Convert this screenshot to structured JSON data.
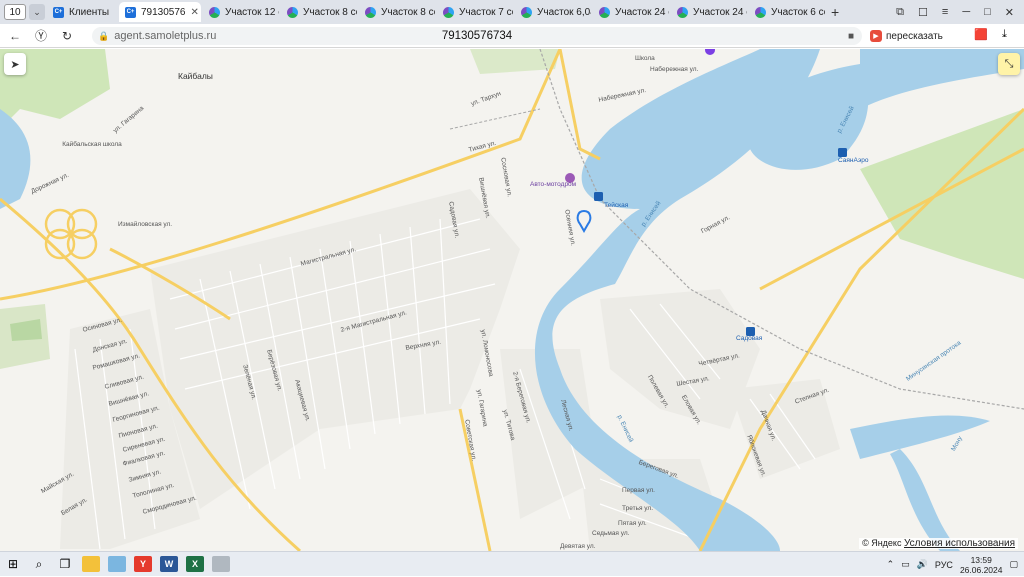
{
  "tabs": {
    "counter": "10",
    "items": [
      {
        "label": "Клиенты",
        "icon": "crm-c-icon",
        "active": false
      },
      {
        "label": "79130576",
        "icon": "crm-c-icon",
        "active": true
      },
      {
        "label": "Участок 12 со",
        "icon": "avito-icon",
        "active": false
      },
      {
        "label": "Участок 8 сот",
        "icon": "avito-icon",
        "active": false
      },
      {
        "label": "Участок 8 сот",
        "icon": "avito-icon",
        "active": false
      },
      {
        "label": "Участок 7 сот",
        "icon": "avito-icon",
        "active": false
      },
      {
        "label": "Участок 6,04",
        "icon": "avito-icon",
        "active": false
      },
      {
        "label": "Участок 24 со",
        "icon": "avito-icon",
        "active": false
      },
      {
        "label": "Участок 24 со",
        "icon": "avito-icon",
        "active": false
      },
      {
        "label": "Участок 6 сот",
        "icon": "avito-icon",
        "active": false
      }
    ]
  },
  "address": {
    "url": "agent.samoletplus.ru",
    "page_title": "79130576734",
    "translate_label": "пересказать"
  },
  "map": {
    "labels": {
      "kaibaly": "Кайбалы",
      "school_kaibaly": "Кайбальская школа",
      "school": "Школа",
      "auto_motodrom": "Авто-мотодром",
      "station_teyskaya": "Тейская",
      "station_sadovaya": "Садовая",
      "sayanaero": "СаянАэро",
      "river_enisey_1": "р. Енисей",
      "river_enisey_2": "р. Енисей",
      "river_enisey_3": "р. Енисей",
      "mountain_canal": "Минусинская протока",
      "monu": "Мону",
      "st_izmaylovskaya": "Измайловская ул.",
      "st_magistralnaya": "Магистральная ул.",
      "st_2_magistralnaya": "2-я Магистральная ул.",
      "st_verkhnyaya": "Верхняя ул.",
      "st_naberezhnaya": "Набережная ул.",
      "st_naberezhnaya2": "Набережная ул.",
      "st_gornaya": "Горная ул.",
      "st_tikhaya": "Тихая ул.",
      "st_sovetskaya": "Советская ул.",
      "st_2_beregovaya": "2-я Береговая ул.",
      "st_beregovaya": "Береговая ул.",
      "st_pervaya": "Первая ул.",
      "st_tretya": "Третья ул.",
      "st_pyataya": "Пятая ул.",
      "st_sedmaya": "Седьмая ул.",
      "st_devyataya": "Девятая ул.",
      "st_shestaya": "Шестая ул.",
      "st_chetvertaya": "Четвёртая ул.",
      "st_osinovaya": "Осиновая ул.",
      "st_donskaya": "Донская ул.",
      "st_romashkovaya": "Ромашковая ул.",
      "st_slivovaya": "Сливовая ул.",
      "st_vishnevaya": "Вишнёвая ул.",
      "st_georginovaya": "Георгиновая ул.",
      "st_pionovaya": "Пионовая ул.",
      "st_sirenevaya": "Сиреневая ул.",
      "st_fialkovaya": "Фиалковая ул.",
      "st_zimnyaya": "Зимняя ул.",
      "st_topolinaya": "Тополиная ул.",
      "st_smorodinovaya": "Смородиновая ул.",
      "st_maiskaya": "Майская ул.",
      "st_belaya": "Белая ул.",
      "st_gagarina": "ул. Гагарина",
      "st_gagarina2": "ул. Гагарина",
      "st_tarhun": "ул. Тархун",
      "st_titova": "ул. Титова",
      "st_lomonosova": "ул. Ломоносова",
      "st_doruzhnaya": "Дорожная ул.",
      "st_sadovaya": "Садовая ул.",
      "st_sosnovaya": "Сосновая ул.",
      "st_vishnevaya2": "Вишнёвая ул.",
      "st_stepnaya": "Степная ул.",
      "st_polevaya": "Полевая ул.",
      "st_osennyaya": "Осенняя ул.",
      "st_lesnaya": "Лесная ул.",
      "st_eloyvaya": "Еловая ул.",
      "st_yablonevaya": "Яблоневая ул.",
      "st_dachnaya": "Дачная ул.",
      "st_berezovaya": "Берёзовая ул.",
      "st_zelenaya": "Зелёная ул.",
      "st_akatsievaya": "Акациевая ул."
    }
  },
  "attribution": {
    "yandex": "© Яндекс",
    "terms": "Условия использования"
  },
  "taskbar": {
    "lang": "РУС",
    "time": "13:59",
    "date": "26.06.2024"
  }
}
